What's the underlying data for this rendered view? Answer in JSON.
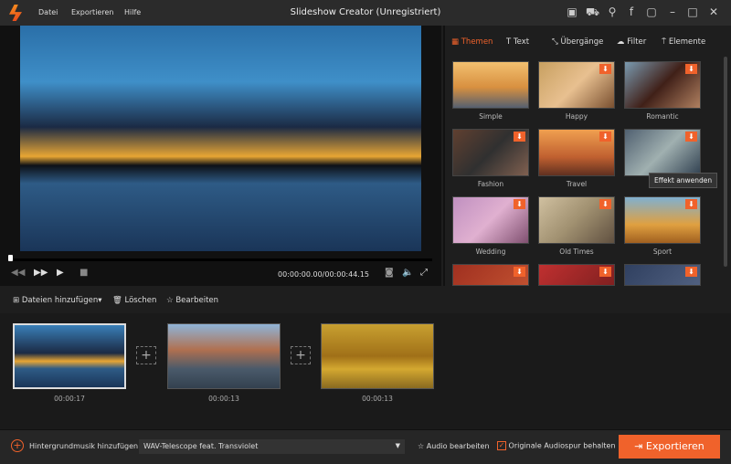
{
  "app": {
    "title": "Slideshow Creator (Unregistriert)",
    "menu": [
      "Datei",
      "Exportieren",
      "Hilfe"
    ],
    "accent": "#f0622b"
  },
  "player": {
    "time": "00:00:00.00/00:00:44.15",
    "progress": 0
  },
  "tabs": [
    {
      "label": "Themen",
      "icon": "grid-icon"
    },
    {
      "label": "Text",
      "icon": "text-icon"
    },
    {
      "label": "Übergänge",
      "icon": "transition-icon"
    },
    {
      "label": "Filter",
      "icon": "filter-icon"
    },
    {
      "label": "Elemente",
      "icon": "paint-roller-icon"
    }
  ],
  "themes": [
    {
      "label": "Simple",
      "download": false
    },
    {
      "label": "Happy",
      "download": true
    },
    {
      "label": "Romantic",
      "download": true
    },
    {
      "label": "Fashion",
      "download": true
    },
    {
      "label": "Travel",
      "download": true
    },
    {
      "label": "",
      "download": true
    },
    {
      "label": "Wedding",
      "download": true
    },
    {
      "label": "Old Times",
      "download": true
    },
    {
      "label": "Sport",
      "download": true
    },
    {
      "label": "",
      "download": true
    },
    {
      "label": "",
      "download": true
    },
    {
      "label": "",
      "download": true
    }
  ],
  "tooltip": "Effekt anwenden",
  "toolbar": {
    "add": "Dateien hinzufügen▾",
    "delete": "Löschen",
    "edit": "Bearbeiten"
  },
  "clips": [
    {
      "duration": "00:00:17"
    },
    {
      "duration": "00:00:13"
    },
    {
      "duration": "00:00:13"
    }
  ],
  "bottom": {
    "music_label": "Hintergrundmusik hinzufügen:",
    "music_value": "WAV-Telescope feat. Transviolet",
    "audio_edit": "Audio bearbeiten",
    "keep_audio": "Originale Audiospur behalten",
    "keep_audio_checked": true,
    "export": "Exportieren"
  }
}
